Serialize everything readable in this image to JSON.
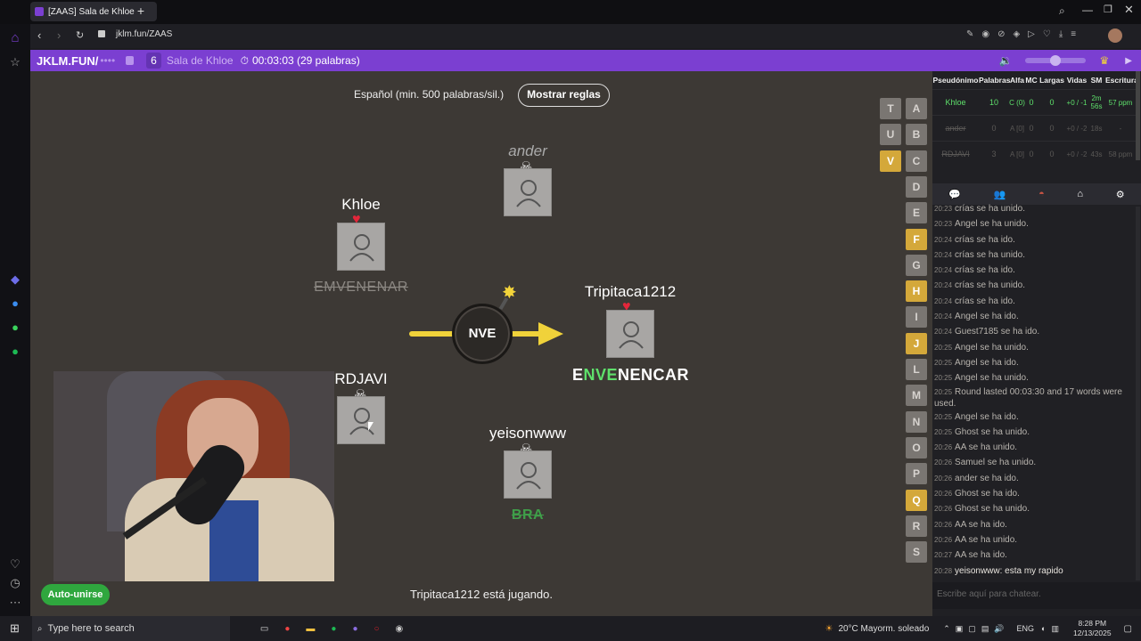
{
  "browser": {
    "tab_title": "[ZAAS] Sala de Khloe",
    "url": "jklm.fun/ZAAS"
  },
  "header": {
    "site": "JKLM.FUN/",
    "hidden_code": "••••",
    "player_count": "6",
    "room_name": "Sala de Khloe",
    "timer": "00:03:03 (29 palabras)"
  },
  "game": {
    "language_rule": "Español (min. 500 palabras/sil.)",
    "rules_button": "Mostrar reglas",
    "syllable": "NVE",
    "status": "Tripitaca1212 está jugando.",
    "auto_join": "Auto-unirse",
    "players": [
      {
        "name": "ander",
        "status": "dead",
        "word": ""
      },
      {
        "name": "Khloe",
        "status": "alive",
        "word": "EMVENENAR",
        "word_style": "strike"
      },
      {
        "name": "Tripitaca1212",
        "status": "alive",
        "word_prefix": "E",
        "word_highlight": "NVE",
        "word_suffix": "NENCAR"
      },
      {
        "name": "RDJAVI",
        "status": "dead",
        "word": ""
      },
      {
        "name": "yeisonwww",
        "status": "dead",
        "word": "BRA",
        "word_style": "strike-green"
      }
    ],
    "letters_left": [
      "T",
      "U",
      "V"
    ],
    "letters_right": [
      "A",
      "B",
      "C",
      "D",
      "E",
      "F",
      "G",
      "H",
      "I",
      "J",
      "L",
      "M",
      "N",
      "O",
      "P",
      "Q",
      "R",
      "S"
    ],
    "letters_on": [
      "V",
      "F",
      "H",
      "J",
      "Q"
    ]
  },
  "stats": {
    "headers": [
      "Pseudónimo",
      "Palabras",
      "Alfa",
      "MC",
      "Largas",
      "Vidas",
      "SM",
      "Escritura"
    ],
    "rows": [
      {
        "name": "Khloe",
        "words": "10",
        "alfa": "C (0)",
        "mc": "0",
        "largas": "0",
        "vidas": "+0 / -1",
        "sm": "2m 56s",
        "esc": "57 ppm"
      },
      {
        "name": "ander",
        "words": "0",
        "alfa": "A [0]",
        "mc": "0",
        "largas": "0",
        "vidas": "+0 / -2",
        "sm": "18s",
        "esc": "-"
      },
      {
        "name": "RDJAVI",
        "words": "3",
        "alfa": "A [0]",
        "mc": "0",
        "largas": "0",
        "vidas": "+0 / -2",
        "sm": "43s",
        "esc": "58 ppm"
      }
    ]
  },
  "chat": {
    "messages": [
      {
        "t": "20:23",
        "m": "crías se ha unido."
      },
      {
        "t": "20:23",
        "m": "Angel se ha unido."
      },
      {
        "t": "20:24",
        "m": "crías se ha ido."
      },
      {
        "t": "20:24",
        "m": "crías se ha unido."
      },
      {
        "t": "20:24",
        "m": "crías se ha ido."
      },
      {
        "t": "20:24",
        "m": "crías se ha unido."
      },
      {
        "t": "20:24",
        "m": "crías se ha ido."
      },
      {
        "t": "20:24",
        "m": "Angel se ha ido."
      },
      {
        "t": "20:24",
        "m": "Guest7185 se ha ido."
      },
      {
        "t": "20:25",
        "m": "Angel se ha unido."
      },
      {
        "t": "20:25",
        "m": "Angel se ha ido."
      },
      {
        "t": "20:25",
        "m": "Angel se ha unido."
      },
      {
        "t": "20:25",
        "m": "Round lasted 00:03:30 and 17 words were used."
      },
      {
        "t": "20:25",
        "m": "Angel se ha ido."
      },
      {
        "t": "20:25",
        "m": "Ghost se ha unido."
      },
      {
        "t": "20:26",
        "m": "AA se ha unido."
      },
      {
        "t": "20:26",
        "m": "Samuel se ha unido."
      },
      {
        "t": "20:26",
        "m": "ander se ha ido."
      },
      {
        "t": "20:26",
        "m": "Ghost se ha ido."
      },
      {
        "t": "20:26",
        "m": "Ghost se ha unido."
      },
      {
        "t": "20:26",
        "m": "AA se ha ido."
      },
      {
        "t": "20:26",
        "m": "AA se ha unido."
      },
      {
        "t": "20:27",
        "m": "AA se ha ido."
      },
      {
        "t": "20:28",
        "m": "yeisonwww: esta my rapido"
      }
    ],
    "placeholder": "Escribe aquí para chatear."
  },
  "taskbar": {
    "search_placeholder": "Type here to search",
    "weather": "20°C  Mayorm. soleado",
    "lang": "ENG",
    "time": "8:28 PM",
    "date": "12/13/2025"
  },
  "colors": {
    "header_purple": "#7b3fd1",
    "green": "#5ee06b",
    "letter_on": "#d4a83a",
    "arrow": "#f0d23a"
  }
}
